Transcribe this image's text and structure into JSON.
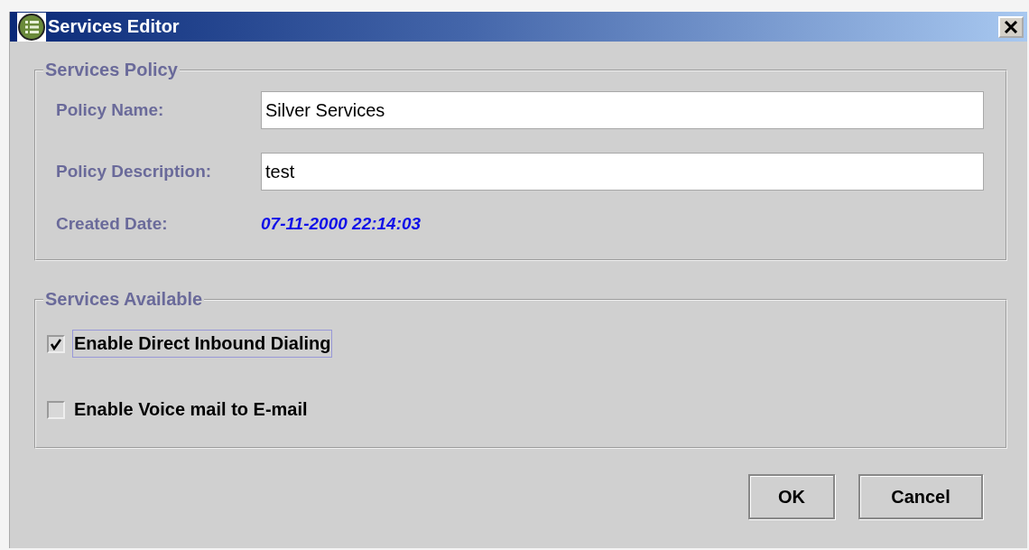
{
  "window": {
    "title": "Services Editor"
  },
  "policy_group": {
    "legend": "Services Policy",
    "fields": [
      {
        "label": "Policy Name:",
        "value": "Silver Services"
      },
      {
        "label": "Policy Description:",
        "value": "test"
      }
    ],
    "created": {
      "label": "Created Date:",
      "value": "07-11-2000 22:14:03"
    }
  },
  "services_group": {
    "legend": "Services Available",
    "options": [
      {
        "label": "Enable Direct Inbound Dialing",
        "checked": true,
        "focused": true
      },
      {
        "label": "Enable Voice mail to E-mail",
        "checked": false,
        "focused": false
      }
    ]
  },
  "buttons": [
    "OK",
    "Cancel"
  ]
}
